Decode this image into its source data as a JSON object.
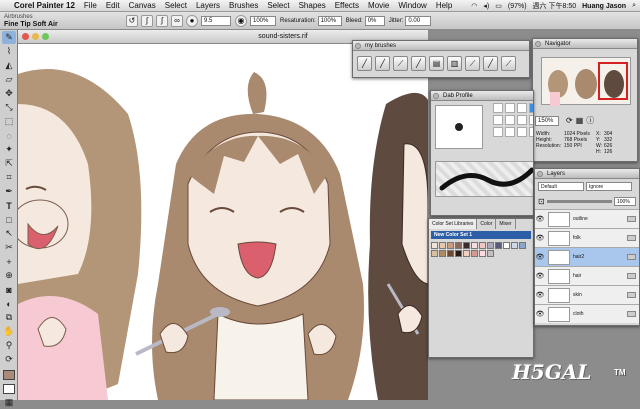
{
  "menubar": {
    "app_name": "Corel Painter 12",
    "items": [
      "File",
      "Edit",
      "Canvas",
      "Select",
      "Layers",
      "Brushes",
      "Select",
      "Shapes",
      "Effects",
      "Movie",
      "Window",
      "Help"
    ],
    "battery": "(97%)",
    "clock": "週六 下午8:50",
    "user": "Huang Jason"
  },
  "propbar": {
    "brush_category": "Airbrushes",
    "brush_variant": "Fine Tip Soft Air",
    "size": "9.5",
    "opacity": "100%",
    "resaturation_label": "Resaturation:",
    "resaturation": "100%",
    "bleed_label": "Bleed:",
    "bleed": "0%",
    "jitter_label": "Jitter:",
    "jitter": "0.00"
  },
  "document": {
    "title": "sound-sisters.rif"
  },
  "my_brushes": {
    "title": "my brushes"
  },
  "navigator": {
    "title": "Navigator",
    "zoom": "150%",
    "width_label": "Width:",
    "width": "1024 Pixels",
    "height_label": "Height:",
    "height": "768 Pixels",
    "resolution_label": "Resolution:",
    "resolution": "150 PPI",
    "x_label": "X:",
    "x": "304",
    "y_label": "Y:",
    "y": "332",
    "w_label": "W:",
    "w": "626",
    "h_label": "H:",
    "h": "126"
  },
  "dab_profile": {
    "title": "Dab Profile"
  },
  "color_set_libraries": {
    "tabs": [
      "Color Set Libraries",
      "Color",
      "Mixer"
    ],
    "set_name": "New Color Set 1",
    "swatches": [
      "#f2e4d4",
      "#e7c8a8",
      "#c89c80",
      "#8a6a5a",
      "#3a2a2a",
      "#f7dede",
      "#efc7c7",
      "#a9a9b9",
      "#5a5a7a",
      "#ffffff",
      "#cfd8e8",
      "#8aa6cc",
      "#d8c0a0",
      "#b08a60",
      "#6a4a30",
      "#2a1a10",
      "#f2d0c0",
      "#d49a90",
      "#ffd8e0",
      "#c0c0c0"
    ]
  },
  "layers": {
    "title": "Layers",
    "composite_method": "Default",
    "composite_depth": "Ignore",
    "opacity": "100%",
    "items": [
      {
        "name": "outline",
        "selected": false
      },
      {
        "name": "folk",
        "selected": false
      },
      {
        "name": "hair2",
        "selected": true
      },
      {
        "name": "hair",
        "selected": false
      },
      {
        "name": "skin",
        "selected": false
      },
      {
        "name": "cloth",
        "selected": false
      }
    ]
  },
  "watermark": {
    "logo": "H5GAL",
    "mark": "TM"
  }
}
